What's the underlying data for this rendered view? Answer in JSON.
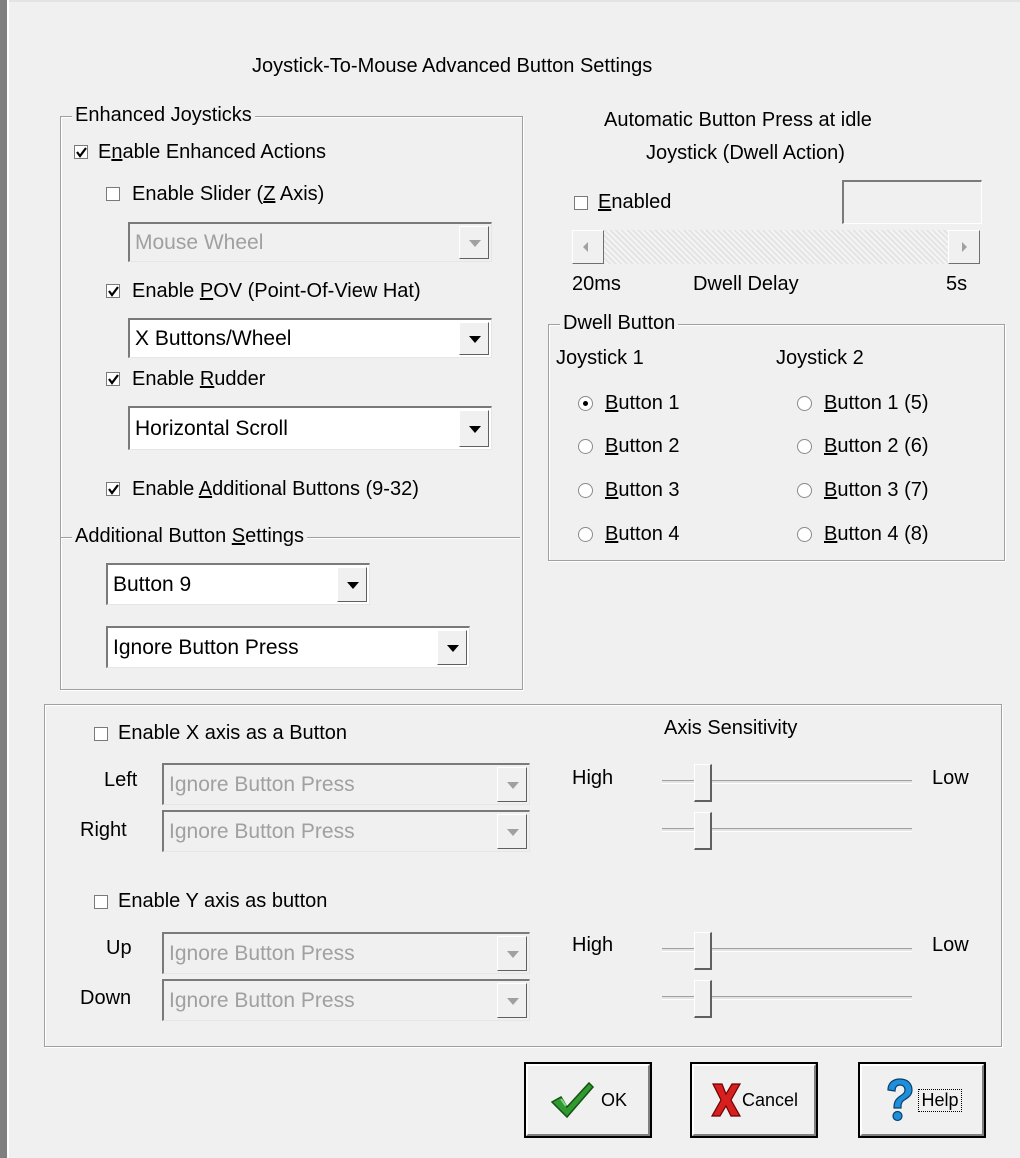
{
  "title": "Joystick-To-Mouse Advanced Button Settings",
  "enhanced": {
    "group_label": "Enhanced Joysticks",
    "enable_actions": {
      "pre": "E",
      "key": "n",
      "post": "able Enhanced Actions",
      "checked": true
    },
    "slider": {
      "pre": "Enable Slider (",
      "key": "Z",
      "post": " Axis)",
      "checked": false,
      "combo_value": "Mouse Wheel"
    },
    "pov": {
      "pre": "Enable ",
      "key": "P",
      "post": "OV (Point-Of-View Hat)",
      "checked": true,
      "combo_value": "X Buttons/Wheel"
    },
    "rudder": {
      "pre": "Enable ",
      "key": "R",
      "post": "udder",
      "checked": true,
      "combo_value": "Horizontal Scroll"
    },
    "additional": {
      "pre": "Enable ",
      "key": "A",
      "post": "dditional Buttons (9-32)",
      "checked": true
    },
    "additional_settings": {
      "pre": "Additional Button ",
      "key": "S",
      "post": "ettings",
      "button_value": "Button 9",
      "action_value": "Ignore Button Press"
    }
  },
  "dwell": {
    "heading_line1": "Automatic Button Press at idle",
    "heading_line2": "Joystick (Dwell Action)",
    "enabled": {
      "key": "E",
      "post": "nabled",
      "checked": false
    },
    "delay_min": "20ms",
    "delay_label": "Dwell Delay",
    "delay_max": "5s",
    "button_group_label": "Dwell Button",
    "joystick1_label": "Joystick 1",
    "joystick2_label": "Joystick 2",
    "joystick1_buttons": [
      {
        "key": "B",
        "post": "utton 1",
        "selected": true
      },
      {
        "key": "B",
        "post": "utton 2",
        "selected": false
      },
      {
        "key": "B",
        "post": "utton 3",
        "selected": false
      },
      {
        "key": "B",
        "post": "utton 4",
        "selected": false
      }
    ],
    "joystick2_buttons": [
      {
        "key": "B",
        "post": "utton 1 (5)",
        "selected": false
      },
      {
        "key": "B",
        "post": "utton 2 (6)",
        "selected": false
      },
      {
        "key": "B",
        "post": "utton 3 (7)",
        "selected": false
      },
      {
        "key": "B",
        "post": "utton 4 (8)",
        "selected": false
      }
    ]
  },
  "axis": {
    "x_enable": {
      "pre": "En",
      "post": "able X axis as a Button",
      "checked": false
    },
    "y_enable": {
      "pre": "En",
      "post": "able Y axis as button",
      "checked": false
    },
    "sensitivity_label": "Axis Sensitivity",
    "high_label": "High",
    "low_label": "Low",
    "left_label": "Left",
    "right_label": "Right",
    "up_label": "Up",
    "down_label": "Down",
    "left_value": "Ignore Button Press",
    "right_value": "Ignore Button Press",
    "up_value": "Ignore Button Press",
    "down_value": "Ignore Button Press"
  },
  "buttons": {
    "ok_label": "OK",
    "cancel_label": "Cancel",
    "help_label": "Help"
  }
}
